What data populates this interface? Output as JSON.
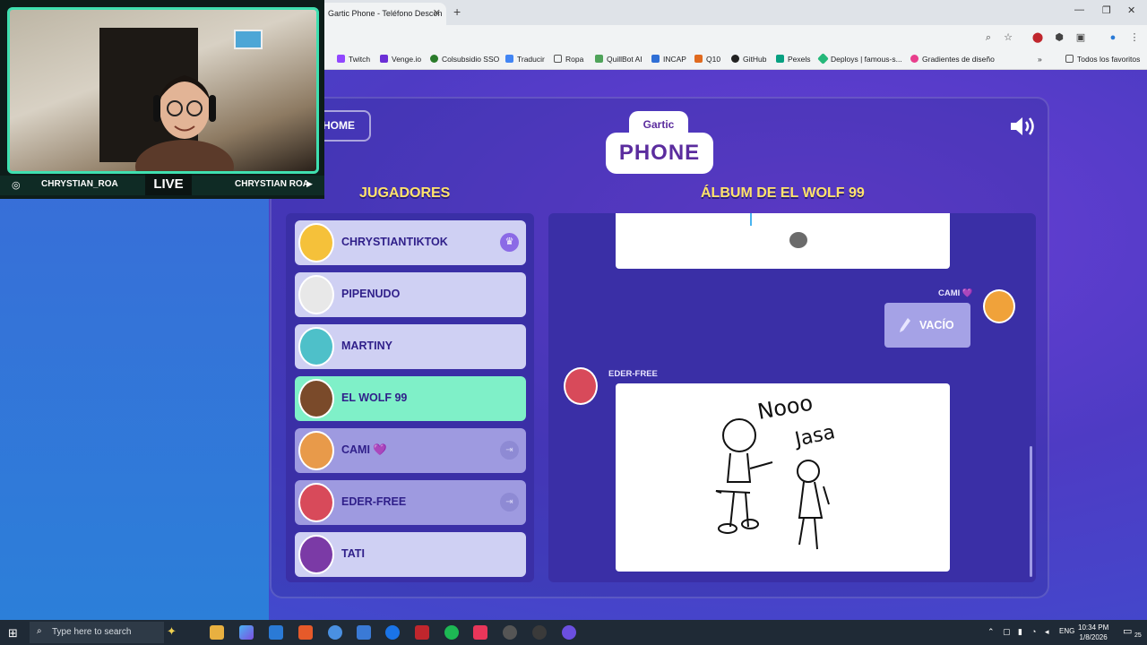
{
  "browser": {
    "tab_title": "Gartic Phone - Teléfono Descon",
    "bookmarks": [
      "Twitch",
      "Venge.io",
      "Colsubsidio SSO",
      "Traducir",
      "Ropa",
      "QuillBot AI",
      "INCAP",
      "Q10",
      "GitHub",
      "Pexels",
      "Deploys | famous-s...",
      "Gradientes de diseño"
    ],
    "all_bookmarks": "Todos los favoritos"
  },
  "page": {
    "home_label": "HOME",
    "logo_top": "Gartic",
    "logo_bottom": "PHONE",
    "players_title": "JUGADORES",
    "album_title": "ÁLBUM DE EL WOLF 99"
  },
  "players": [
    {
      "name": "CHRYSTIANTIKTOK",
      "state": "host"
    },
    {
      "name": "PIPENUDO",
      "state": "normal"
    },
    {
      "name": "MARTINY",
      "state": "normal"
    },
    {
      "name": "EL WOLF 99",
      "state": "active"
    },
    {
      "name": "CAMI 💜",
      "state": "left"
    },
    {
      "name": "EDER-FREE",
      "state": "left"
    },
    {
      "name": "TATI",
      "state": "normal"
    }
  ],
  "album": {
    "cami_label": "CAMI 💜",
    "vacio_label": "VACÍO",
    "eder_label": "EDER-FREE",
    "drawing_words": [
      "Nooo",
      "Jasa"
    ]
  },
  "webcam": {
    "left_name": "CHRYSTIAN_ROA",
    "live": "LIVE",
    "right_name": "CHRYSTIAN ROA"
  },
  "taskbar": {
    "search_placeholder": "Type here to search",
    "lang": "ENG",
    "time": "10:34 PM",
    "date": "1/8/2026",
    "notif": "25"
  }
}
